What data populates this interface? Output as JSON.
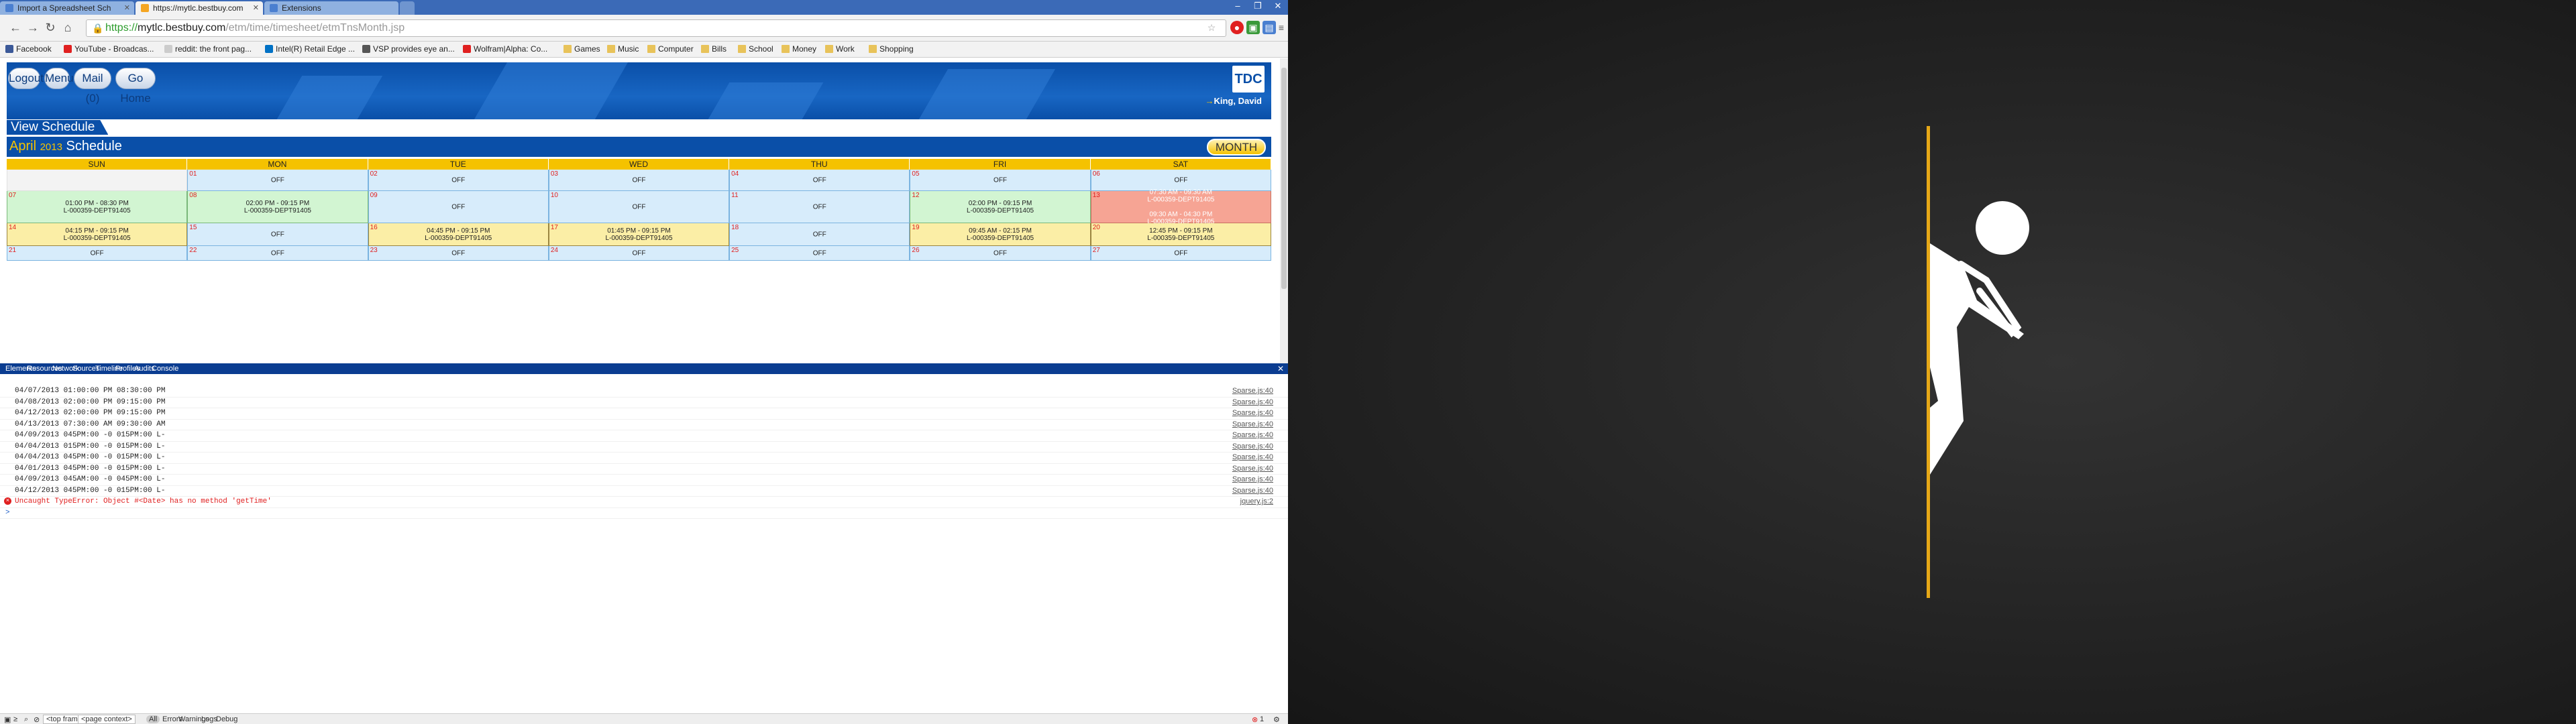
{
  "browser": {
    "tabs": [
      {
        "title": "Import a Spreadsheet Sch",
        "color": "#4a7fd0",
        "active": false
      },
      {
        "title": "https://mytlc.bestbuy.com",
        "color": "#f5a623",
        "active": true
      },
      {
        "title": "Extensions",
        "color": "#4a7fd0",
        "active": false
      }
    ],
    "url_scheme": "https://",
    "url_host": "mytlc.bestbuy.com",
    "url_path": "/etm/time/timesheet/etmTnsMonth.jsp",
    "bookmarks": [
      {
        "label": "Facebook",
        "type": "site",
        "color": "#3b5998"
      },
      {
        "label": "YouTube - Broadcas...",
        "type": "site",
        "color": "#e02020"
      },
      {
        "label": "reddit: the front pag...",
        "type": "site",
        "color": "#ccc"
      },
      {
        "label": "Intel(R) Retail Edge ...",
        "type": "site",
        "color": "#0071c5"
      },
      {
        "label": "VSP provides eye an...",
        "type": "site",
        "color": "#555"
      },
      {
        "label": "Wolfram|Alpha: Co...",
        "type": "site",
        "color": "#e02020"
      },
      {
        "label": "Games",
        "type": "folder"
      },
      {
        "label": "Music",
        "type": "folder"
      },
      {
        "label": "Computer",
        "type": "folder"
      },
      {
        "label": "Bills",
        "type": "folder"
      },
      {
        "label": "School",
        "type": "folder"
      },
      {
        "label": "Money",
        "type": "folder"
      },
      {
        "label": "Work",
        "type": "folder"
      },
      {
        "label": "Shopping",
        "type": "folder"
      }
    ]
  },
  "page": {
    "nav_buttons": [
      "Logout",
      "Menu",
      "Mail (0)",
      "Go Home"
    ],
    "logo_text": "TDC",
    "user_name": "King, David",
    "view_schedule": "View Schedule",
    "month_name": "April",
    "year": "2013",
    "schedule_word": "Schedule",
    "month_button": "MONTH",
    "weekdays": [
      "SUN",
      "MON",
      "TUE",
      "WED",
      "THU",
      "FRI",
      "SAT"
    ],
    "weeks": [
      [
        {
          "day": "",
          "lines": [],
          "style": "blank"
        },
        {
          "day": "01",
          "lines": [
            "OFF"
          ],
          "style": "off"
        },
        {
          "day": "02",
          "lines": [
            "OFF"
          ],
          "style": "off"
        },
        {
          "day": "03",
          "lines": [
            "OFF"
          ],
          "style": "off"
        },
        {
          "day": "04",
          "lines": [
            "OFF"
          ],
          "style": "off"
        },
        {
          "day": "05",
          "lines": [
            "OFF"
          ],
          "style": "off"
        },
        {
          "day": "06",
          "lines": [
            "OFF"
          ],
          "style": "off"
        }
      ],
      [
        {
          "day": "07",
          "lines": [
            "01:00 PM - 08:30 PM",
            "L-000359-DEPT91405"
          ],
          "style": "green"
        },
        {
          "day": "08",
          "lines": [
            "02:00 PM - 09:15 PM",
            "L-000359-DEPT91405"
          ],
          "style": "green"
        },
        {
          "day": "09",
          "lines": [
            "OFF"
          ],
          "style": "off"
        },
        {
          "day": "10",
          "lines": [
            "OFF"
          ],
          "style": "off"
        },
        {
          "day": "11",
          "lines": [
            "OFF"
          ],
          "style": "off"
        },
        {
          "day": "12",
          "lines": [
            "02:00 PM - 09:15 PM",
            "L-000359-DEPT91405"
          ],
          "style": "green"
        },
        {
          "day": "13",
          "lines": [
            "07:30 AM - 09:30 AM",
            "L-000359-DEPT91405",
            "",
            "09:30 AM - 04:30 PM",
            "L-000359-DEPT91405"
          ],
          "style": "red"
        }
      ],
      [
        {
          "day": "14",
          "lines": [
            "04:15 PM - 09:15 PM",
            "L-000359-DEPT91405"
          ],
          "style": "yellow"
        },
        {
          "day": "15",
          "lines": [
            "OFF"
          ],
          "style": "off"
        },
        {
          "day": "16",
          "lines": [
            "04:45 PM - 09:15 PM",
            "L-000359-DEPT91405"
          ],
          "style": "yellow"
        },
        {
          "day": "17",
          "lines": [
            "01:45 PM - 09:15 PM",
            "L-000359-DEPT91405"
          ],
          "style": "yellow"
        },
        {
          "day": "18",
          "lines": [
            "OFF"
          ],
          "style": "off"
        },
        {
          "day": "19",
          "lines": [
            "09:45 AM - 02:15 PM",
            "L-000359-DEPT91405"
          ],
          "style": "yellow"
        },
        {
          "day": "20",
          "lines": [
            "12:45 PM - 09:15 PM",
            "L-000359-DEPT91405"
          ],
          "style": "yellow"
        }
      ],
      [
        {
          "day": "21",
          "lines": [
            "OFF"
          ],
          "style": "off"
        },
        {
          "day": "22",
          "lines": [
            "OFF"
          ],
          "style": "off"
        },
        {
          "day": "23",
          "lines": [
            "OFF"
          ],
          "style": "off"
        },
        {
          "day": "24",
          "lines": [
            "OFF"
          ],
          "style": "off"
        },
        {
          "day": "25",
          "lines": [
            "OFF"
          ],
          "style": "off"
        },
        {
          "day": "26",
          "lines": [
            "OFF"
          ],
          "style": "off"
        },
        {
          "day": "27",
          "lines": [
            "OFF"
          ],
          "style": "off"
        }
      ]
    ]
  },
  "devtools": {
    "tabs": [
      "Elements",
      "Resources",
      "Network",
      "Sources",
      "Timeline",
      "Profiles",
      "Audits",
      "Console"
    ],
    "log_lines": [
      {
        "text": "04/07/2013 01:00:00 PM 08:30:00 PM",
        "src": "Sparse.js:40"
      },
      {
        "text": "04/08/2013 02:00:00 PM 09:15:00 PM",
        "src": "Sparse.js:40"
      },
      {
        "text": "04/12/2013 02:00:00 PM 09:15:00 PM",
        "src": "Sparse.js:40"
      },
      {
        "text": "04/13/2013 07:30:00 AM 09:30:00 AM",
        "src": "Sparse.js:40"
      },
      {
        "text": "04/09/2013 045PM:00 -0 015PM:00 L-",
        "src": "Sparse.js:40"
      },
      {
        "text": "04/04/2013 015PM:00 -0 015PM:00 L-",
        "src": "Sparse.js:40"
      },
      {
        "text": "04/04/2013 045PM:00 -0 015PM:00 L-",
        "src": "Sparse.js:40"
      },
      {
        "text": "04/01/2013 045PM:00 -0 015PM:00 L-",
        "src": "Sparse.js:40"
      },
      {
        "text": "04/09/2013 045AM:00 -0 045PM:00 L-",
        "src": "Sparse.js:40"
      },
      {
        "text": "04/12/2013 045PM:00 -0 015PM:00 L-",
        "src": "Sparse.js:40"
      }
    ],
    "error_text": "Uncaught TypeError: Object #<Date> has no method 'getTime'",
    "error_src": "jquery.js:2",
    "prompt": ">",
    "frame_select": "<top frame>",
    "context_select": "<page context>",
    "filters": [
      "All",
      "Errors",
      "Warnings",
      "Logs",
      "Debug"
    ],
    "error_count": "1"
  }
}
